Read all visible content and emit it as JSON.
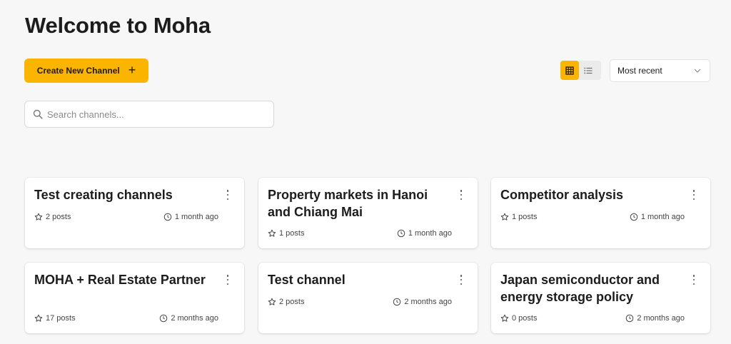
{
  "header": {
    "title": "Welcome to Moha"
  },
  "toolbar": {
    "create_label": "Create New Channel",
    "create_icon": "plus-icon",
    "view_modes": [
      {
        "name": "grid",
        "icon": "grid-icon",
        "active": true
      },
      {
        "name": "list",
        "icon": "list-icon",
        "active": false
      }
    ],
    "sort": {
      "selected": "Most recent"
    }
  },
  "search": {
    "placeholder": "Search channels...",
    "value": ""
  },
  "colors": {
    "accent": "#fbb400",
    "background": "#f7f7f7",
    "card": "#ffffff"
  },
  "channels": [
    {
      "title": "Test creating channels",
      "posts": "2 posts",
      "updated": "1 month ago"
    },
    {
      "title": "Property markets in Hanoi and Chiang Mai",
      "posts": "1 posts",
      "updated": "1 month ago"
    },
    {
      "title": "Competitor analysis",
      "posts": "1 posts",
      "updated": "1 month ago"
    },
    {
      "title": "MOHA + Real Estate Partner",
      "posts": "17 posts",
      "updated": "2 months ago"
    },
    {
      "title": "Test channel",
      "posts": "2 posts",
      "updated": "2 months ago"
    },
    {
      "title": "Japan semiconductor and energy storage policy",
      "posts": "0 posts",
      "updated": "2 months ago"
    }
  ]
}
